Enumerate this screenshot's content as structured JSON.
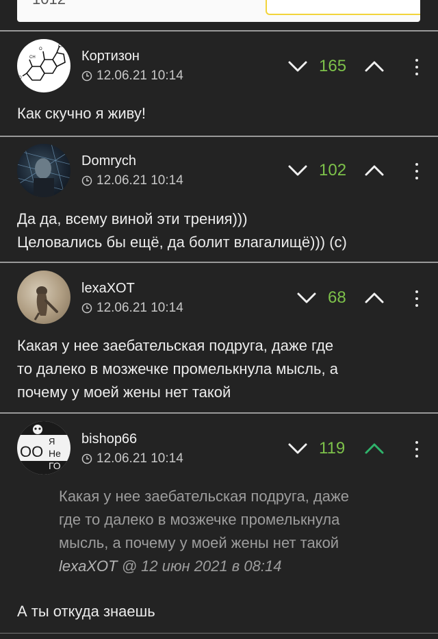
{
  "top_card": {
    "partial_number": "1012"
  },
  "comments": [
    {
      "username": "Кортизон",
      "timestamp": "12.06.21 10:14",
      "score": "165",
      "upvoted": false,
      "text_lines": [
        "Как скучно я живу!"
      ]
    },
    {
      "username": "Domrych",
      "timestamp": "12.06.21 10:14",
      "score": "102",
      "upvoted": false,
      "text_lines": [
        "Да да, всему виной эти трения)))",
        "Целовались бы ещё, да болит влагалищё))) (с)"
      ]
    },
    {
      "username": "lexaXOT",
      "timestamp": "12.06.21 10:14",
      "score": "68",
      "upvoted": false,
      "text_lines": [
        "Какая у нее заебательская подруга, даже где",
        "то далеко в мозжечке промелькнула мысль, а",
        "почему у моей жены нет такой"
      ]
    },
    {
      "username": "bishop66",
      "timestamp": "12.06.21 10:14",
      "score": "119",
      "upvoted": true,
      "quote": {
        "lines": [
          "Какая у нее заебательская подруга, даже",
          "где то далеко в мозжечке промелькнула",
          "мысль, а почему у моей жены нет такой"
        ],
        "ref_user": "lexaXOT",
        "ref_rest": " @ 12 июн 2021 в 08:14"
      },
      "text_lines": [
        "А ты откуда знаешь"
      ]
    }
  ],
  "colors": {
    "background": "#232323",
    "score": "#7dc14a",
    "upvote_active": "#2fb36b",
    "divider": "#9a9a9a"
  },
  "icons": [
    "clock-icon",
    "chevron-down-icon",
    "chevron-up-icon",
    "more-vertical-icon"
  ]
}
